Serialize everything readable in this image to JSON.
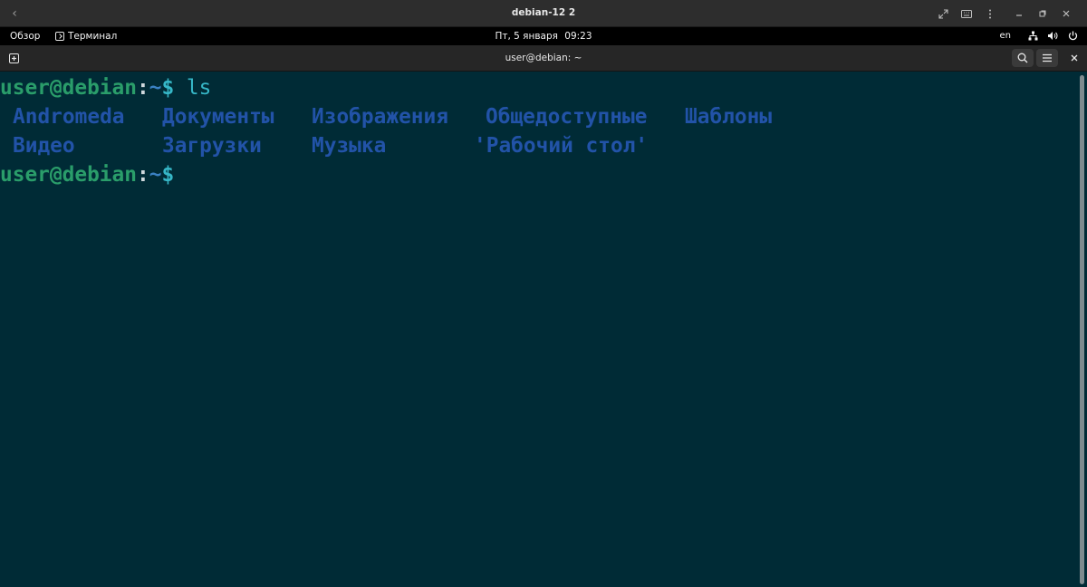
{
  "vm_window": {
    "title": "debian-12 2",
    "back_icon": "chevron-left-icon",
    "controls": [
      "fullscreen-icon",
      "keyboard-icon",
      "more-vertical-icon",
      "minimize-icon",
      "restore-icon",
      "close-icon"
    ]
  },
  "gnome_panel": {
    "overview_label": "Обзор",
    "app_label": "Терминал",
    "clock_day": "Пт, 5 января",
    "clock_time": "09:23",
    "language": "en",
    "tray_icons": [
      "network-icon",
      "volume-icon",
      "power-icon"
    ]
  },
  "terminal": {
    "title": "user@debian: ~",
    "prompt_user": "user@debian",
    "prompt_colon": ":",
    "prompt_path": "~",
    "prompt_dollar": "$",
    "command": " ls",
    "listing": {
      "row1": [
        "Andromeda",
        "Документы",
        "Изображения",
        "Общедоступные",
        "Шаблоны"
      ],
      "row2": [
        "Видео",
        "Загрузки",
        "Музыка",
        "'Рабочий стол'"
      ]
    }
  },
  "colors": {
    "terminal_bg": "#002b36",
    "prompt_user": "#2a9d6a",
    "prompt_path": "#3b82c4",
    "prompt_cmd": "#36b7c7",
    "directory": "#2253a8"
  }
}
